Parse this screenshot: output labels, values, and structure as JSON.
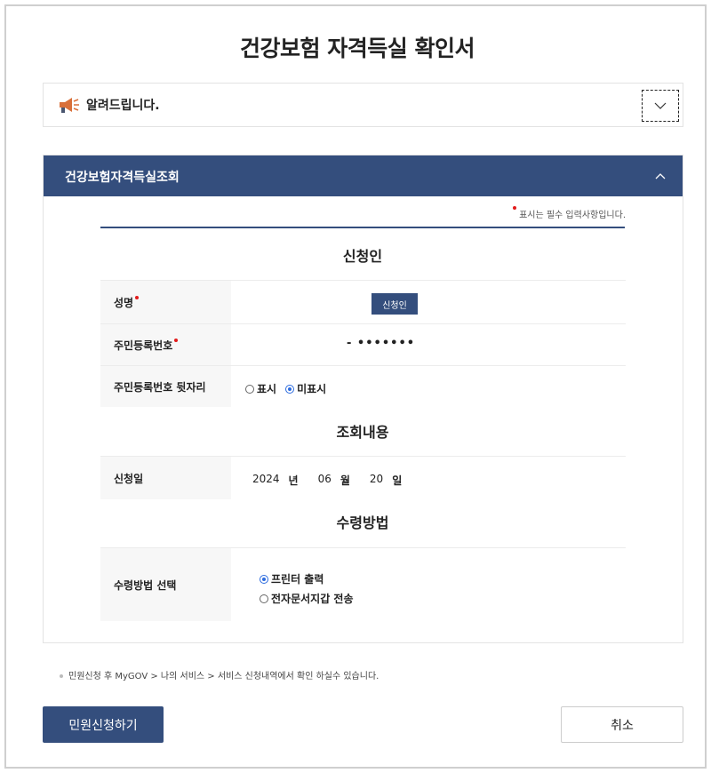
{
  "page": {
    "title": "건강보험 자격득실 확인서"
  },
  "notice": {
    "label": "알려드립니다.",
    "icon": "megaphone-icon"
  },
  "panel": {
    "title": "건강보험자격득실조회",
    "required_note": "표시는 필수 입력사항입니다."
  },
  "sections": {
    "applicant": "신청인",
    "inquiry": "조회내용",
    "receipt": "수령방법"
  },
  "fields": {
    "name_label": "성명",
    "name_button": "신청인",
    "rrn_label": "주민등록번호",
    "rrn_value": "-  •••••••",
    "rrn_back_label": "주민등록번호 뒷자리",
    "rrn_back_options": [
      "표시",
      "미표시"
    ],
    "rrn_back_selected": "미표시",
    "date_label": "신청일",
    "date_year": "2024",
    "date_year_unit": "년",
    "date_month": "06",
    "date_month_unit": "월",
    "date_day": "20",
    "date_day_unit": "일",
    "receipt_label": "수령방법 선택",
    "receipt_options": [
      "프린터 출력",
      "전자문서지갑 전송"
    ],
    "receipt_selected": "프린터 출력"
  },
  "footnote": "민원신청 후 MyGOV > 나의 서비스 > 서비스 신청내역에서 확인 하실수 있습니다.",
  "buttons": {
    "submit": "민원신청하기",
    "cancel": "취소"
  },
  "colors": {
    "primary": "#344e7d",
    "required": "#e21b1b",
    "radio": "#2d6cdf"
  }
}
